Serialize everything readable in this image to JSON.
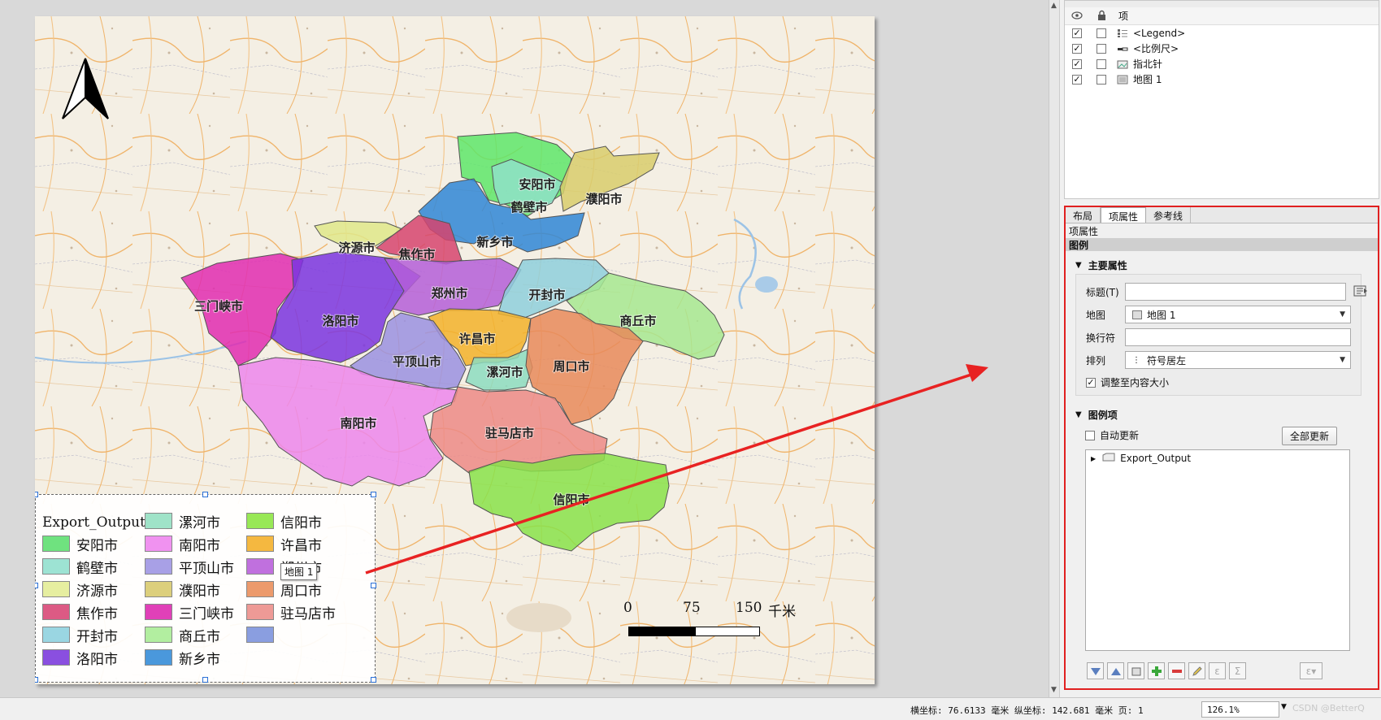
{
  "map": {
    "north_arrow_icon": "north-arrow-icon",
    "cities": [
      {
        "name": "安阳市",
        "color": "#5ee66a"
      },
      {
        "name": "鹤壁市",
        "color": "#8fe0c8"
      },
      {
        "name": "濮阳市",
        "color": "#d8cd6c"
      },
      {
        "name": "新乡市",
        "color": "#2f86d6"
      },
      {
        "name": "济源市",
        "color": "#dfe88a"
      },
      {
        "name": "焦作市",
        "color": "#d6446e"
      },
      {
        "name": "三门峡市",
        "color": "#e02bb0"
      },
      {
        "name": "洛阳市",
        "color": "#7a34df"
      },
      {
        "name": "郑州市",
        "color": "#b45ed8"
      },
      {
        "name": "开封市",
        "color": "#8ecfdc"
      },
      {
        "name": "商丘市",
        "color": "#a6e890"
      },
      {
        "name": "许昌市",
        "color": "#f2b22a"
      },
      {
        "name": "平顶山市",
        "color": "#9a90e0"
      },
      {
        "name": "漯河市",
        "color": "#8cdcc0"
      },
      {
        "name": "周口市",
        "color": "#e88a5a"
      },
      {
        "name": "南阳市",
        "color": "#ec86ec"
      },
      {
        "name": "驻马店市",
        "color": "#ec8a86"
      },
      {
        "name": "信阳市",
        "color": "#88e24a"
      }
    ]
  },
  "legend": {
    "title": "Export_Output",
    "items": [
      {
        "label": "安阳市",
        "color": "#6fe27f"
      },
      {
        "label": "鹤壁市",
        "color": "#9de3d3"
      },
      {
        "label": "济源市",
        "color": "#e6eea0"
      },
      {
        "label": "焦作市",
        "color": "#dc5a84"
      },
      {
        "label": "开封市",
        "color": "#9ad6e2"
      },
      {
        "label": "洛阳市",
        "color": "#8a4fe0"
      },
      {
        "label": "漯河市",
        "color": "#9fe3c8"
      },
      {
        "label": "南阳市",
        "color": "#f092f0"
      },
      {
        "label": "平顶山市",
        "color": "#a8a0e6"
      },
      {
        "label": "濮阳市",
        "color": "#dccf7c"
      },
      {
        "label": "三门峡市",
        "color": "#e040b8"
      },
      {
        "label": "商丘市",
        "color": "#b2eea0"
      },
      {
        "label": "新乡市",
        "color": "#4a98dc"
      },
      {
        "label": "信阳市",
        "color": "#98e856"
      },
      {
        "label": "许昌市",
        "color": "#f5b840"
      },
      {
        "label": "郑州市",
        "color": "#c070de"
      },
      {
        "label": "周口市",
        "color": "#ec9a6c"
      },
      {
        "label": "驻马店市",
        "color": "#ee9a96"
      },
      {
        "label": "",
        "color": "#8a9ee0"
      }
    ],
    "tooltip": "地图 1"
  },
  "scalebar": {
    "labels": [
      "0",
      "75",
      "150"
    ],
    "unit": "千米"
  },
  "items_panel": {
    "top_label": "项",
    "header": {
      "name": "项"
    },
    "rows": [
      {
        "label": "<Legend>",
        "visible": true,
        "locked": false,
        "icon": "legend-icon"
      },
      {
        "label": "<比例尺>",
        "visible": true,
        "locked": false,
        "icon": "scalebar-icon"
      },
      {
        "label": "指北针",
        "visible": true,
        "locked": false,
        "icon": "picture-icon"
      },
      {
        "label": "地图 1",
        "visible": true,
        "locked": false,
        "icon": "map-icon"
      }
    ]
  },
  "props_panel": {
    "tabs": [
      "布局",
      "项属性",
      "参考线"
    ],
    "active_tab": "项属性",
    "panel_title": "项属性",
    "section_title": "图例",
    "main_group": {
      "title": "主要属性",
      "title_label": "标题(T)",
      "title_value": "",
      "map_label": "地图",
      "map_value": "地图 1",
      "wrap_label": "换行符",
      "wrap_value": "",
      "arrange_label": "排列",
      "arrange_value": "符号居左",
      "resize_label": "调整至内容大小",
      "resize_checked": true
    },
    "items_group": {
      "title": "图例项",
      "auto_update_label": "自动更新",
      "update_all_label": "全部更新",
      "tree_root": "Export_Output"
    }
  },
  "statusbar": {
    "coords": "横坐标: 76.6133 毫米 纵坐标: 142.681 毫米 页: 1",
    "zoom": "126.1%",
    "watermark": "CSDN @BetterQ"
  }
}
